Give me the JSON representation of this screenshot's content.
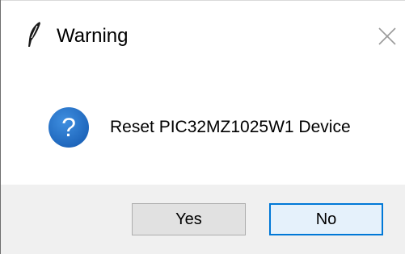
{
  "window": {
    "title": "Warning",
    "app_icon": "feather-icon",
    "close_icon": "close-icon"
  },
  "message": {
    "icon": "question-icon",
    "text": "Reset PIC32MZ1025W1 Device"
  },
  "buttons": {
    "yes_label": "Yes",
    "no_label": "No"
  },
  "colors": {
    "question_icon": "#1f6fc5",
    "default_button_border": "#0078d7",
    "footer_background": "#f0f0f0"
  }
}
